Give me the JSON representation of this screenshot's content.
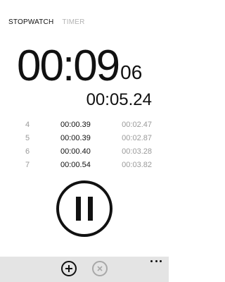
{
  "tabs": [
    {
      "label": "STOPWATCH",
      "active": true
    },
    {
      "label": "TIMER",
      "active": false
    }
  ],
  "main_time": {
    "major": "00:09",
    "minor": "06"
  },
  "current_lap_time": "00:05.24",
  "laps": [
    {
      "number": "4",
      "split": "00:00.39",
      "total": "00:02.47"
    },
    {
      "number": "5",
      "split": "00:00.39",
      "total": "00:02.87"
    },
    {
      "number": "6",
      "split": "00:00.40",
      "total": "00:03.28"
    },
    {
      "number": "7",
      "split": "00:00.54",
      "total": "00:03.82"
    }
  ],
  "controls": {
    "pause_icon": "pause-icon",
    "add_icon": "plus-circle-icon",
    "clear_icon": "x-circle-icon",
    "more_icon": "ellipsis-icon"
  },
  "colors": {
    "background": "#ffffff",
    "foreground": "#111111",
    "muted": "#9a9a9a",
    "inactive_tab": "#b3b3b3",
    "appbar": "#e4e4e4",
    "disabled": "#a8a8a8"
  }
}
